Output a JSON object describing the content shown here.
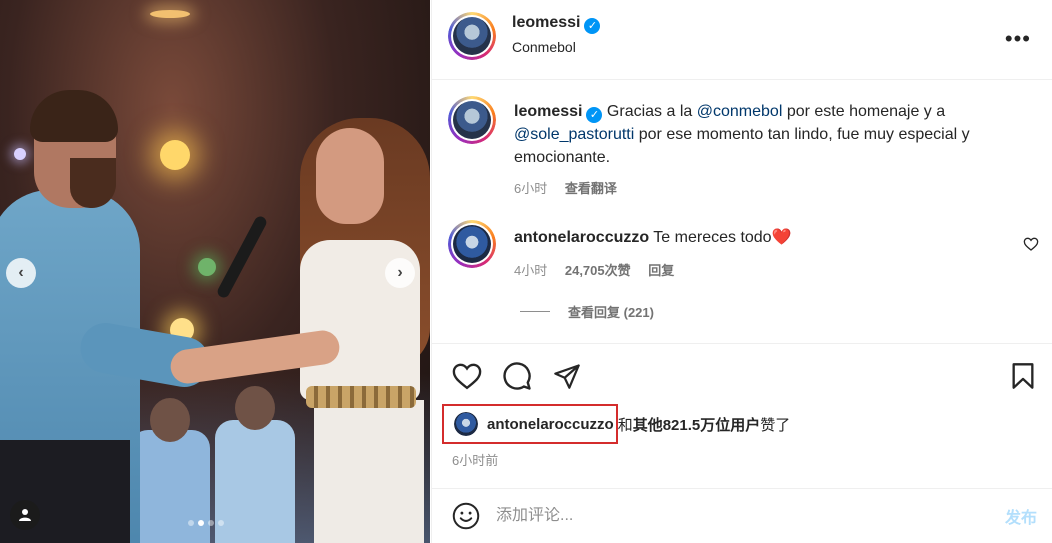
{
  "photo": {
    "prev_label": "‹",
    "next_label": "›",
    "slide_count": 4,
    "active_slide": 2
  },
  "header": {
    "username": "leomessi",
    "verified": true,
    "subtitle": "Conmebol",
    "more_label": "•••"
  },
  "caption": {
    "username": "leomessi",
    "text_1": " Gracias a la ",
    "mention_1": "@conmebol",
    "text_2": " por este homenaje y a ",
    "mention_2": "@sole_pastorutti",
    "text_3": " por ese momento tan lindo, fue muy especial y emocionante.",
    "time": "6小时",
    "translate": "查看翻译"
  },
  "comment": {
    "username": "antonelaroccuzzo",
    "text": " Te mereces todo",
    "heart_emoji": "❤️",
    "time": "4小时",
    "likes": "24,705次赞",
    "reply": "回复",
    "view_replies": "查看回复 (221)"
  },
  "likes": {
    "username": "antonelaroccuzzo",
    "joiner": "和",
    "others": "其他821.5万位用户",
    "suffix": "赞了"
  },
  "post_time": "6小时前",
  "comment_input": {
    "placeholder": "添加评论...",
    "post_label": "发布"
  },
  "icons": {
    "like": "heart-outline-icon",
    "comment": "speech-bubble-icon",
    "share": "paper-plane-icon",
    "save": "bookmark-icon",
    "emoji": "smiley-icon"
  },
  "colors": {
    "link": "#00376b",
    "verified": "#0095f6",
    "highlight_box": "#d42c2c",
    "post_disabled": "#b3dffc",
    "heart": "#e3262c"
  }
}
